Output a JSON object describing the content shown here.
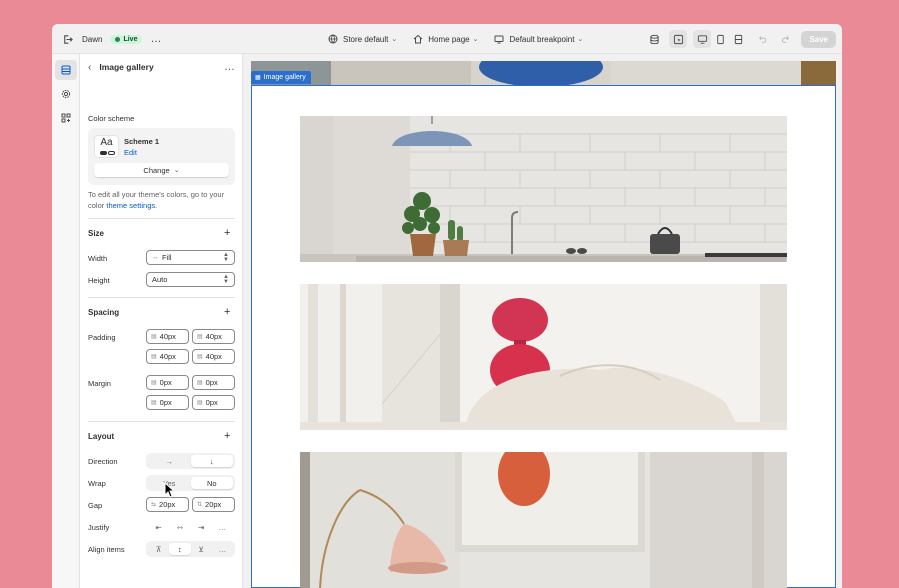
{
  "topbar": {
    "store_name": "Dawn",
    "status": "Live",
    "menu": "…",
    "store_selector": "Store default",
    "page_selector": "Home page",
    "breakpoint_selector": "Default breakpoint",
    "save_label": "Save"
  },
  "sidebar": {
    "title": "Image gallery",
    "menu": "…",
    "color_scheme": {
      "label": "Color scheme",
      "swatch_text": "Aa",
      "scheme_name": "Scheme 1",
      "edit_label": "Edit",
      "change_label": "Change",
      "help_text": "To edit all your theme's colors, go to your color",
      "help_link": "theme settings",
      "help_suffix": "."
    },
    "size": {
      "title": "Size",
      "width_label": "Width",
      "width_value": "Fill",
      "width_icon": "↔",
      "height_label": "Height",
      "height_value": "Auto"
    },
    "spacing": {
      "title": "Spacing",
      "padding_label": "Padding",
      "padding": [
        "40px",
        "40px",
        "40px",
        "40px"
      ],
      "margin_label": "Margin",
      "margin": [
        "0px",
        "0px",
        "0px",
        "0px"
      ]
    },
    "layout": {
      "title": "Layout",
      "direction_label": "Direction",
      "direction_options": [
        "→",
        "↓"
      ],
      "wrap_label": "Wrap",
      "wrap_options": [
        "Yes",
        "No"
      ],
      "gap_label": "Gap",
      "gap": [
        "20px",
        "20px"
      ],
      "justify_label": "Justify",
      "justify_more": "…",
      "align_label": "Align items",
      "align_more": "…"
    }
  },
  "canvas": {
    "section_tag": "Image gallery"
  },
  "colors": {
    "background": "#ea8a96",
    "accent_blue": "#2c6ecb",
    "live_green": "#29845a"
  }
}
